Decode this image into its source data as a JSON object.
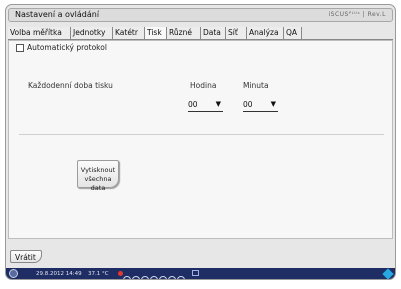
{
  "window": {
    "title": "Nastavení a ovládání",
    "logo_text": "iSCUSᴾᴸᵁˢ | Rev.L"
  },
  "tabs": [
    {
      "label": "Volba měřítka"
    },
    {
      "label": "Jednotky"
    },
    {
      "label": "Katétr"
    },
    {
      "label": "Tisk",
      "active": true
    },
    {
      "label": "Různé"
    },
    {
      "label": "Data"
    },
    {
      "label": "Síť"
    },
    {
      "label": "Analýza"
    },
    {
      "label": "QA"
    }
  ],
  "print": {
    "auto_protocol_label": "Automatický protokol",
    "auto_protocol_checked": false,
    "daily_time_label": "Každodenní doba tisku",
    "hour_label": "Hodina",
    "minute_label": "Minuta",
    "hour_value": "00",
    "minute_value": "00",
    "print_all_line1": "Vytisknout",
    "print_all_line2": "všechna data"
  },
  "back_label": "Vrátit",
  "statusbar": {
    "datetime": "29.8.2012 14:49",
    "temperature": "37.1 °C"
  },
  "colors": {
    "statusbar_bg": "#1e2d63",
    "panel_bg": "#f7f7f7",
    "alert_dot": "#e23a2e",
    "status_right": "#27a8e0"
  },
  "icons": [
    "checkbox-icon",
    "dropdown-arrow-icon",
    "power-icon",
    "alert-dot-icon",
    "network-icon",
    "status-diamond-icon"
  ]
}
